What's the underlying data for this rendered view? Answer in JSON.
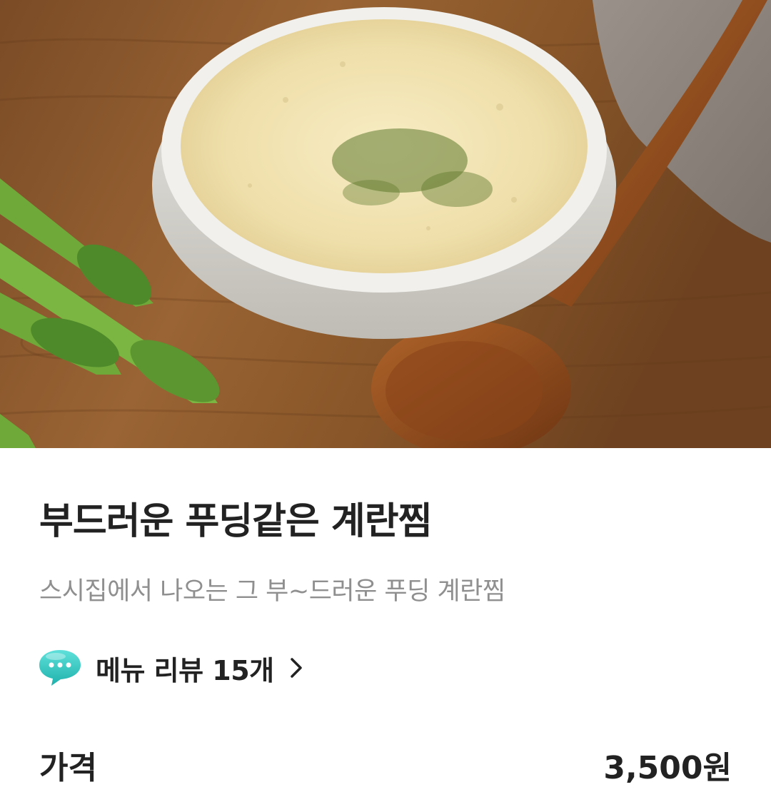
{
  "menu": {
    "name": "부드러운 푸딩같은 계란찜",
    "description": "스시집에서 나오는 그 부~드러운 푸딩 계란찜",
    "review_link_label": "메뉴 리뷰 15개",
    "review_icon": "speech-bubble-icon",
    "chevron_icon": "chevron-right-icon"
  },
  "price": {
    "label": "가격",
    "value": "3,500원"
  },
  "colors": {
    "text_primary": "#222222",
    "text_secondary": "#8f8f8f",
    "review_icon": "#2ac1bc"
  }
}
